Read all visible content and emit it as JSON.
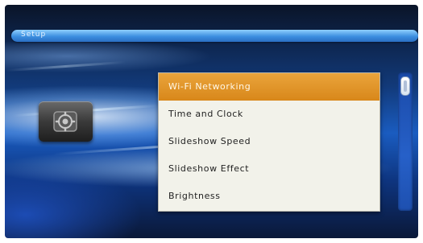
{
  "header": {
    "title": "Setup"
  },
  "category": {
    "icon": "settings-gear-icon"
  },
  "menu": {
    "items": [
      {
        "label": "Wi-Fi Networking",
        "selected": true
      },
      {
        "label": "Time and Clock",
        "selected": false
      },
      {
        "label": "Slideshow Speed",
        "selected": false
      },
      {
        "label": "Slideshow Effect",
        "selected": false
      },
      {
        "label": "Brightness",
        "selected": false
      }
    ]
  },
  "colors": {
    "selection": "#e09a2c",
    "menu_background": "#f2f2ea",
    "title_bar": "#4a9ae8"
  }
}
